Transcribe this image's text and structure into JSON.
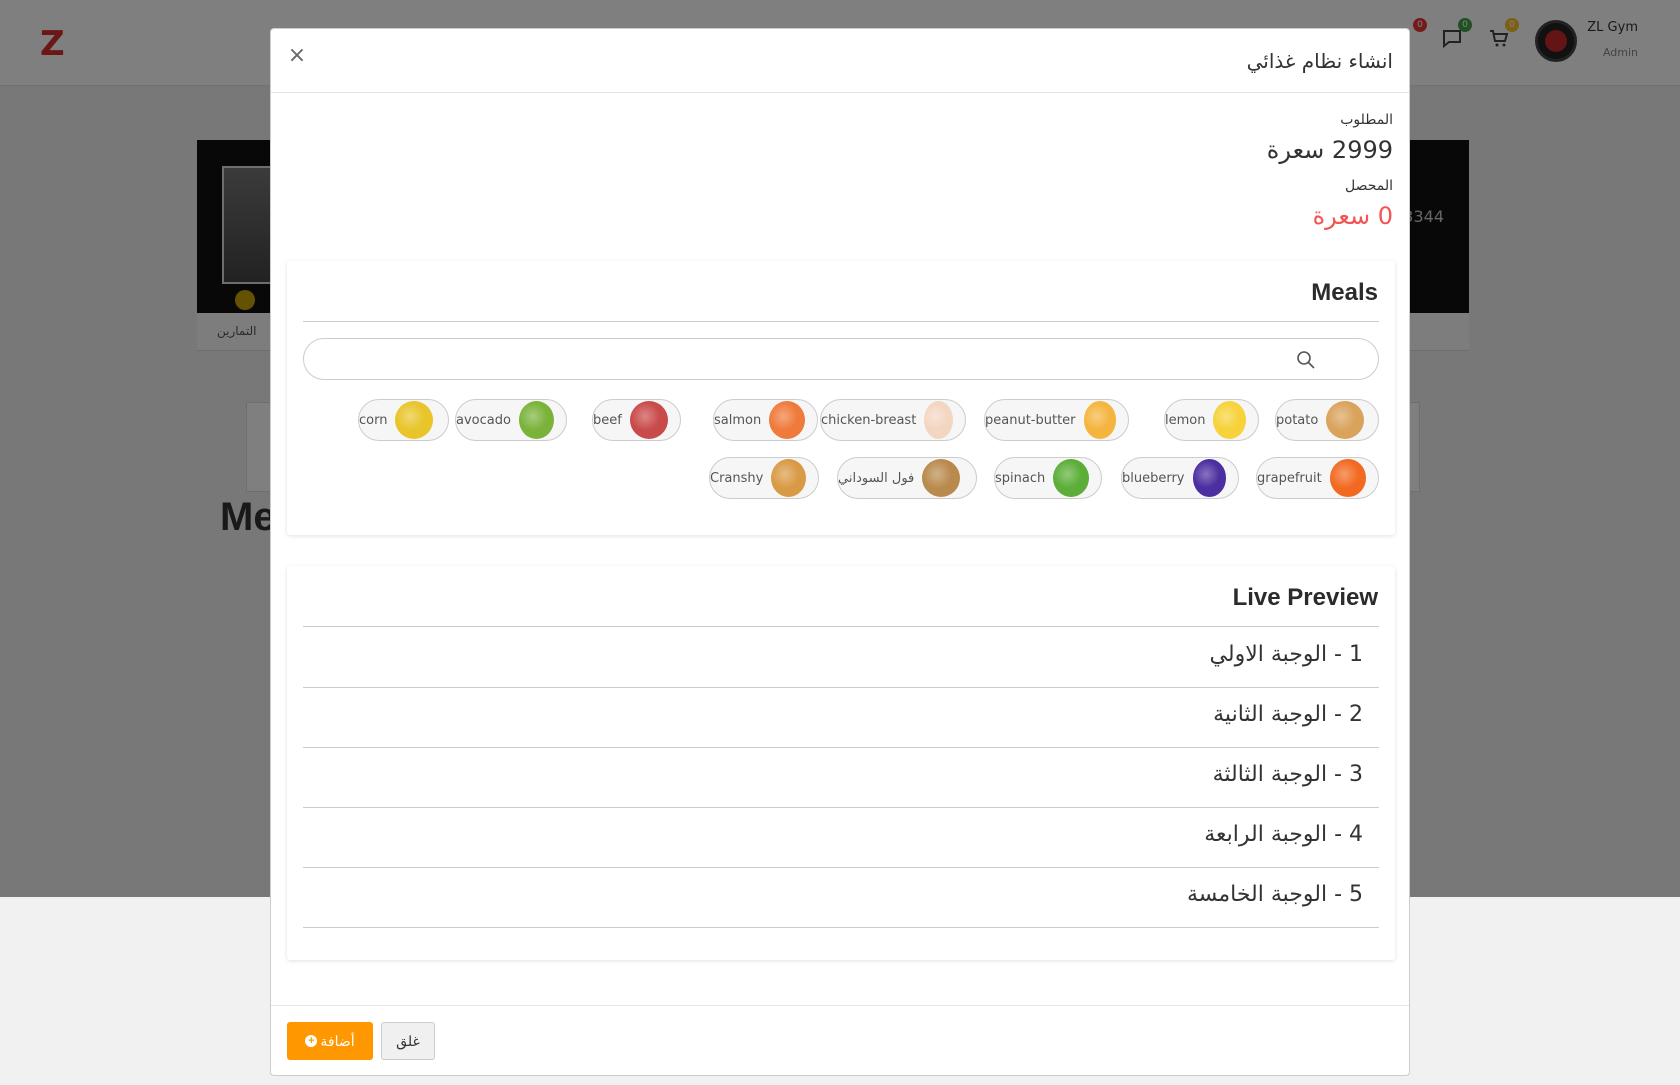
{
  "topbar": {
    "user_name": "ZL Gym",
    "user_role": "Admin",
    "cart_count": "0",
    "messages_count": "0",
    "notifications_count": "0"
  },
  "background": {
    "cover_number": "3344",
    "profile_tab": "التمارين",
    "heading": "Me"
  },
  "modal": {
    "title": "انشاء نظام غذائي",
    "close_symbol": "×",
    "required_label": "المطلوب",
    "required_value": "2999 سعرة",
    "achieved_label": "المحصل",
    "achieved_value": "0 سعرة"
  },
  "meals_card": {
    "title": "Meals",
    "search_placeholder": "",
    "items": [
      {
        "label": "potato",
        "icon": "potato-icon",
        "color": "#d9a35c"
      },
      {
        "label": "lemon",
        "icon": "lemon-icon",
        "color": "#f7d23a"
      },
      {
        "label": "peanut-butter",
        "icon": "peanut-butter-icon",
        "color": "#f4b53f"
      },
      {
        "label": "chicken-breast",
        "icon": "chicken-breast-icon",
        "color": "#f3d6c2"
      },
      {
        "label": "salmon",
        "icon": "salmon-icon",
        "color": "#f07a3b"
      },
      {
        "label": "beef",
        "icon": "beef-icon",
        "color": "#c94a4a"
      },
      {
        "label": "avocado",
        "icon": "avocado-icon",
        "color": "#7bb33a"
      },
      {
        "label": "corn",
        "icon": "corn-icon",
        "color": "#e8c52a"
      },
      {
        "label": "grapefruit",
        "icon": "grapefruit-icon",
        "color": "#f26a21"
      },
      {
        "label": "blueberry",
        "icon": "blueberry-icon",
        "color": "#4b2ea0"
      },
      {
        "label": "spinach",
        "icon": "spinach-icon",
        "color": "#5cae38"
      },
      {
        "label": "فول السوداني",
        "icon": "peanut-icon",
        "color": "#b98a4e"
      },
      {
        "label": "Cranshy",
        "icon": "sandwich-icon",
        "color": "#d99a45"
      }
    ]
  },
  "preview_card": {
    "title": "Live Preview",
    "meals": [
      "1 - الوجبة الاولي",
      "2 - الوجبة الثانية",
      "3 - الوجبة الثالثة",
      "4 - الوجبة الرابعة",
      "5 - الوجبة الخامسة"
    ]
  },
  "footer": {
    "add_label": "أضافة",
    "close_label": "غلق"
  },
  "colors": {
    "accent": "#ff9800",
    "danger": "#f25454",
    "brand": "#d62e2e"
  }
}
